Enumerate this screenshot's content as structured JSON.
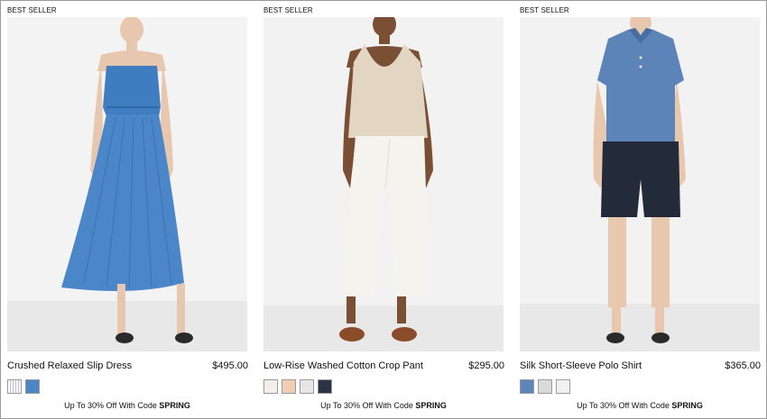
{
  "products": [
    {
      "badge": "BEST SELLER",
      "name": "Crushed Relaxed Slip Dress",
      "price": "$495.00",
      "swatches": [
        "#e9e0ef",
        "#4a86c8"
      ],
      "promo_prefix": "Up To 30% Off With Code",
      "promo_code": "SPRING"
    },
    {
      "badge": "BEST SELLER",
      "name": "Low-Rise Washed Cotton Crop Pant",
      "price": "$295.00",
      "swatches": [
        "#f1f0ec",
        "#f0cdb3",
        "#e6e6e6",
        "#2b3447"
      ],
      "promo_prefix": "Up To 30% Off With Code",
      "promo_code": "SPRING"
    },
    {
      "badge": "BEST SELLER",
      "name": "Silk Short-Sleeve Polo Shirt",
      "price": "$365.00",
      "swatches": [
        "#5e86bb",
        "#dadada",
        "#f1f1f1"
      ],
      "promo_prefix": "Up To 30% Off With Code",
      "promo_code": "SPRING"
    }
  ],
  "colors": {
    "dress_blue": "#3f7cc0",
    "tank_beige": "#e2d6c3",
    "pant_white": "#f4f3ee",
    "shirt_blue": "#5c84b8",
    "shorts_navy": "#232a3a",
    "skin_light": "#e7c8ae",
    "skin_dark": "#7a4f33",
    "sandal_brown": "#8a4c2a",
    "backdrop": "#f0f0f0"
  }
}
